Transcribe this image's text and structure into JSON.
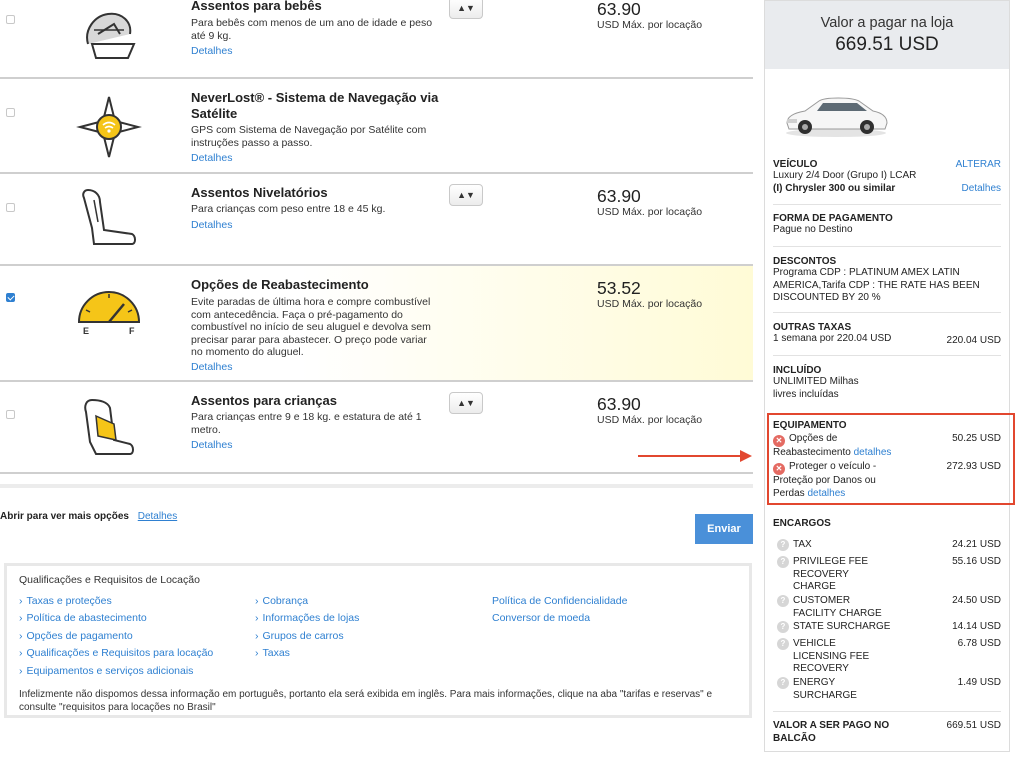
{
  "extras": [
    {
      "title": "Assentos para bebês",
      "desc": [
        "Para bebês com menos de um ano de idade e peso",
        "até 9 kg."
      ],
      "details": "Detalhes",
      "price": "63.90",
      "unit": "USD Máx. por locação",
      "has_qty": true,
      "checked": false
    },
    {
      "title": "NeverLost® - Sistema de Navegação via Satélite",
      "title_lines": [
        "NeverLost® - Sistema de Navegação via",
        "Satélite"
      ],
      "desc": [
        "GPS com Sistema de Navegação por Satélite com",
        "instruções passo a passo."
      ],
      "details": "Detalhes",
      "checked": false
    },
    {
      "title": "Assentos Nivelatórios",
      "desc": [
        "Para crianças com peso entre 18 e 45 kg."
      ],
      "details": "Detalhes",
      "price": "63.90",
      "unit": "USD Máx. por locação",
      "has_qty": true,
      "checked": false
    },
    {
      "title": "Opções de Reabastecimento",
      "desc": [
        "Evite paradas de última hora e compre combustível",
        "com antecedência. Faça o pré-pagamento do",
        "combustível no início de seu aluguel e devolva sem",
        "precisar parar para abastecer. O preço pode variar",
        "no momento do aluguel."
      ],
      "details": "Detalhes",
      "price": "53.52",
      "unit": "USD Máx. por locação",
      "checked": true,
      "gauge_e": "E",
      "gauge_f": "F"
    },
    {
      "title": "Assentos para crianças",
      "desc": [
        "Para crianças entre 9 e 18 kg. e estatura de até 1",
        "metro."
      ],
      "details": "Detalhes",
      "price": "63.90",
      "unit": "USD Máx. por locação",
      "has_qty": true,
      "checked": false
    }
  ],
  "more_options": {
    "label": "Abrir para ver mais opções",
    "link": "Detalhes"
  },
  "send_button": "Enviar",
  "qualifications": {
    "title": "Qualificações e Requisitos de Locação",
    "col1": [
      "Taxas e proteções",
      "Política de abastecimento",
      "Opções de pagamento",
      "Qualificações e Requisitos para locação",
      "Equipamentos e serviços adicionais"
    ],
    "col2": [
      "Cobrança",
      "Informações de lojas",
      "Grupos de carros",
      "Taxas"
    ],
    "col3": [
      "Política de Confidencialidade",
      "Conversor de moeda"
    ],
    "note": "Infelizmente não dispomos dessa informação em português, portanto ela será exibida em inglês. Para mais informações, clique na aba \"tarifas e reservas\" e consulte \"requisitos para locações no Brasil\""
  },
  "summary": {
    "pay_label": "Valor a pagar na loja",
    "pay_amount": "669.51 USD",
    "vehicle": {
      "heading": "VEÍCULO",
      "change": "ALTERAR",
      "line1": "Luxury 2/4 Door (Grupo I) LCAR",
      "line2": "(I) Chrysler 300 ou similar",
      "details": "Detalhes"
    },
    "payment": {
      "heading": "FORMA DE PAGAMENTO",
      "text": "Pague no Destino"
    },
    "discounts": {
      "heading": "DESCONTOS",
      "lines": [
        "Programa CDP : PLATINUM AMEX LATIN",
        "AMERICA,Tarifa CDP : THE RATE HAS BEEN",
        "DISCOUNTED BY 20 %"
      ]
    },
    "other_fees": {
      "heading": "OUTRAS TAXAS",
      "text": "1 semana por 220.04 USD",
      "amount": "220.04 USD"
    },
    "included": {
      "heading": "INCLUÍDO",
      "lines": [
        "UNLIMITED Milhas",
        "livres incluídas"
      ]
    },
    "equipment": {
      "heading": "EQUIPAMENTO",
      "items": [
        {
          "lines": [
            "Opções de",
            "Reabastecimento"
          ],
          "link": "detalhes",
          "amount": "50.25 USD"
        },
        {
          "lines": [
            "Proteger o veículo -",
            "Proteção por Danos ou",
            "Perdas"
          ],
          "link": "detalhes",
          "amount": "272.93 USD"
        }
      ]
    },
    "charges": {
      "heading": "ENCARGOS",
      "items": [
        {
          "lines": [
            "TAX"
          ],
          "amount": "24.21 USD"
        },
        {
          "lines": [
            "PRIVILEGE FEE",
            "RECOVERY",
            "CHARGE"
          ],
          "amount": "55.16 USD"
        },
        {
          "lines": [
            "CUSTOMER",
            "FACILITY CHARGE"
          ],
          "amount": "24.50 USD"
        },
        {
          "lines": [
            "STATE SURCHARGE"
          ],
          "amount": "14.14 USD"
        },
        {
          "lines": [
            "VEHICLE",
            "LICENSING FEE",
            "RECOVERY"
          ],
          "amount": "6.78 USD"
        },
        {
          "lines": [
            "ENERGY",
            "SURCHARGE"
          ],
          "amount": "1.49 USD"
        }
      ]
    },
    "total": {
      "lines": [
        "VALOR A SER PAGO NO",
        "BALCÃO"
      ],
      "amount": "669.51 USD"
    }
  },
  "colors": {
    "accent": "#2f80d1",
    "highlight_box": "#e2472f",
    "gauge": "#f5c518",
    "button": "#4a90d9"
  },
  "icons": [
    "infant-seat-icon",
    "compass-gps-icon",
    "booster-seat-icon",
    "fuel-gauge-icon",
    "child-seat-icon",
    "car-image",
    "remove-icon",
    "help-icon",
    "arrow-icon"
  ]
}
